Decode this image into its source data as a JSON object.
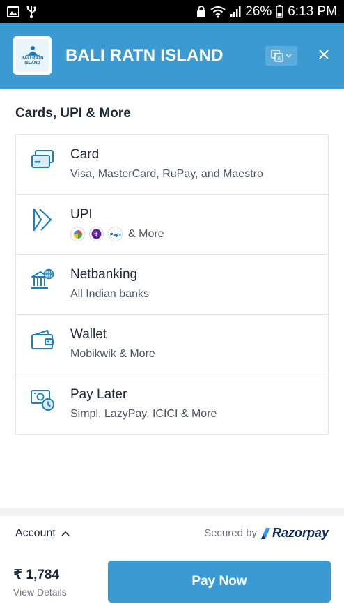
{
  "status_bar": {
    "battery": "26%",
    "time": "6:13 PM",
    "icons": [
      "image-icon",
      "usb-icon",
      "lock-icon",
      "wifi-icon",
      "signal-icon",
      "battery-icon"
    ]
  },
  "header": {
    "logo_text": "BALI RATN ISLAND",
    "merchant_name": "BALI RATN ISLAND",
    "language_icon": "translate-icon",
    "close_icon": "close-icon",
    "background_color": "#3b9ad2"
  },
  "section_title": "Cards, UPI & More",
  "methods": [
    {
      "title": "Card",
      "subtitle": "Visa, MasterCard, RuPay, and Maestro",
      "icon": "card-icon"
    },
    {
      "title": "UPI",
      "apps": [
        "google-pay-icon",
        "phonepe-icon",
        "paytm-icon"
      ],
      "subtitle": "& More",
      "icon": "upi-icon"
    },
    {
      "title": "Netbanking",
      "subtitle": "All Indian banks",
      "icon": "bank-icon"
    },
    {
      "title": "Wallet",
      "subtitle": "Mobikwik & More",
      "icon": "wallet-icon"
    },
    {
      "title": "Pay Later",
      "subtitle": "Simpl, LazyPay, ICICI & More",
      "icon": "pay-later-icon"
    }
  ],
  "footer": {
    "account_label": "Account",
    "secured_by": "Secured by",
    "brand": "Razorpay",
    "amount": "₹ 1,784",
    "view_details": "View Details",
    "pay_button": "Pay Now"
  },
  "colors": {
    "accent": "#3b9ad2",
    "icon_blue": "#1b7fbf"
  }
}
